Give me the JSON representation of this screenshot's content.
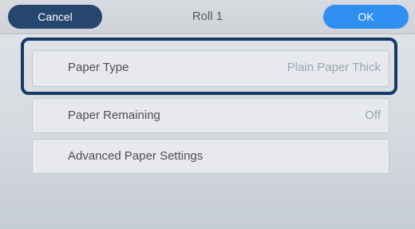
{
  "header": {
    "cancel_label": "Cancel",
    "title": "Roll 1",
    "ok_label": "OK"
  },
  "settings": {
    "items": [
      {
        "label": "Paper Type",
        "value": "Plain Paper Thick",
        "selected": true
      },
      {
        "label": "Paper Remaining",
        "value": "Off",
        "selected": false
      },
      {
        "label": "Advanced Paper Settings",
        "value": "",
        "selected": false
      }
    ]
  },
  "colors": {
    "cancel_button": "#26456f",
    "ok_button": "#2f8ff0",
    "focus_ring": "#163a67",
    "value_text": "#9aa7b4"
  }
}
